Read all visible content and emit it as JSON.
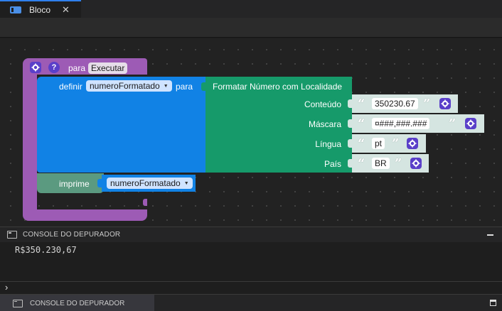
{
  "tab": {
    "label": "Bloco",
    "close": "✕"
  },
  "blocks": {
    "proc": {
      "keyword": "para",
      "name": "Executar"
    },
    "set": {
      "keyword": "definir",
      "variable": "numeroFormatado",
      "to": "para"
    },
    "format": {
      "title": "Formatar Número com Localidade",
      "inputs": [
        {
          "label": "Conteúdo",
          "value": "350230.67"
        },
        {
          "label": "Máscara",
          "value": "¤###,###.###"
        },
        {
          "label": "Língua",
          "value": "pt"
        },
        {
          "label": "País",
          "value": "BR"
        }
      ]
    },
    "print": {
      "keyword": "imprime",
      "variable": "numeroFormatado"
    }
  },
  "quotes": {
    "open": "“",
    "close": "”"
  },
  "console": {
    "title": "CONSOLE DO DEPURADOR",
    "output": "R$350.230,67",
    "prompt": "›"
  },
  "statusbar": {
    "tab_label": "CONSOLE DO DEPURADOR"
  },
  "colors": {
    "procedure": "#9d5bb5",
    "variable": "#1182e5",
    "text": "#169a6a",
    "print": "#5b9a80",
    "accent": "#2f80ed",
    "mutator": "#5a3fc9"
  },
  "icons": {
    "tab": "blocks-icon",
    "gear": "gear-icon",
    "help": "help-icon",
    "console": "terminal-icon"
  }
}
